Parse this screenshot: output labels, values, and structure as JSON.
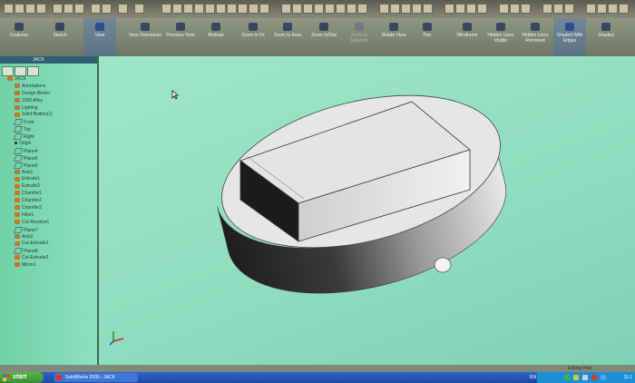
{
  "toolbar": {
    "buttons": [
      {
        "label": "Features",
        "icon": "features-icon"
      },
      {
        "label": "Sketch",
        "icon": "sketch-icon"
      },
      {
        "label": "View",
        "icon": "view-icon"
      },
      {
        "label": "View Orientation",
        "icon": "view-orientation-icon"
      },
      {
        "label": "Previous View",
        "icon": "previous-view-icon"
      },
      {
        "label": "Redraw",
        "icon": "redraw-icon"
      },
      {
        "label": "Zoom to Fit",
        "icon": "zoom-fit-icon"
      },
      {
        "label": "Zoom to Area",
        "icon": "zoom-area-icon"
      },
      {
        "label": "Zoom In/Out",
        "icon": "zoom-inout-icon"
      },
      {
        "label": "Zoom to Selection",
        "icon": "zoom-selection-icon"
      },
      {
        "label": "Rotate View",
        "icon": "rotate-view-icon"
      },
      {
        "label": "Pan",
        "icon": "pan-icon"
      },
      {
        "label": "Wireframe",
        "icon": "wireframe-icon"
      },
      {
        "label": "Hidden Lines Visible",
        "icon": "hidden-lines-visible-icon"
      },
      {
        "label": "Hidden Lines Removed",
        "icon": "hidden-lines-removed-icon"
      },
      {
        "label": "Shaded With Edges",
        "icon": "shaded-edges-icon"
      },
      {
        "label": "Shaded",
        "icon": "shaded-icon"
      }
    ]
  },
  "panel": {
    "title": "JACK",
    "tree": [
      {
        "label": "JACK",
        "indent": 0,
        "icon": "part-icon"
      },
      {
        "label": "Annotations",
        "indent": 1,
        "icon": "annotations-icon"
      },
      {
        "label": "Design Binder",
        "indent": 1,
        "icon": "design-binder-icon"
      },
      {
        "label": "1060 Alloy",
        "indent": 1,
        "icon": "material-icon"
      },
      {
        "label": "Lighting",
        "indent": 1,
        "icon": "lighting-icon"
      },
      {
        "label": "Solid Bodies(1)",
        "indent": 1,
        "icon": "solid-bodies-icon"
      },
      {
        "label": "Front",
        "indent": 1,
        "icon": "plane-icon"
      },
      {
        "label": "Top",
        "indent": 1,
        "icon": "plane-icon"
      },
      {
        "label": "Right",
        "indent": 1,
        "icon": "plane-icon"
      },
      {
        "label": "Origin",
        "indent": 1,
        "icon": "origin-icon"
      },
      {
        "label": "Plane4",
        "indent": 1,
        "icon": "plane-icon"
      },
      {
        "label": "Plane5",
        "indent": 1,
        "icon": "plane-icon"
      },
      {
        "label": "Plane6",
        "indent": 1,
        "icon": "plane-icon"
      },
      {
        "label": "Axis1",
        "indent": 1,
        "icon": "axis-icon"
      },
      {
        "label": "Extrude1",
        "indent": 1,
        "icon": "extrude-icon"
      },
      {
        "label": "Extrude2",
        "indent": 1,
        "icon": "extrude-icon"
      },
      {
        "label": "Chamfer1",
        "indent": 1,
        "icon": "chamfer-icon"
      },
      {
        "label": "Chamfer2",
        "indent": 1,
        "icon": "chamfer-icon"
      },
      {
        "label": "Chamfer3",
        "indent": 1,
        "icon": "chamfer-icon"
      },
      {
        "label": "Fillet1",
        "indent": 1,
        "icon": "fillet-icon"
      },
      {
        "label": "Cut-Revolve1",
        "indent": 1,
        "icon": "cut-revolve-icon"
      },
      {
        "label": "Plane7",
        "indent": 1,
        "icon": "plane-icon"
      },
      {
        "label": "Axis2",
        "indent": 1,
        "icon": "axis-icon"
      },
      {
        "label": "Cut-Extrude1",
        "indent": 1,
        "icon": "cut-extrude-icon"
      },
      {
        "label": "Plane8",
        "indent": 1,
        "icon": "plane-icon"
      },
      {
        "label": "Cut-Extrude2",
        "indent": 1,
        "icon": "cut-extrude-icon"
      },
      {
        "label": "Mirror1",
        "indent": 1,
        "icon": "mirror-icon"
      }
    ]
  },
  "status": {
    "right": "Editing Part"
  },
  "taskbar": {
    "start": "start",
    "window": "SolidWorks 2005 - JACK",
    "lang": "EN",
    "clock": "11:1"
  },
  "colors": {
    "viewport_bg": "#9fe6c8",
    "panel_bg": "#7fd8b4",
    "taskbar": "#2a5cc0",
    "start_green": "#4aa53c"
  }
}
